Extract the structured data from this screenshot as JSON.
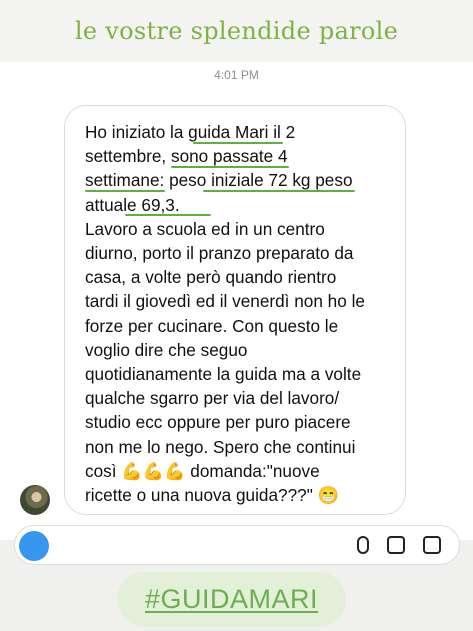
{
  "banner": {
    "title": "le vostre splendide parole"
  },
  "chat": {
    "timestamp": "4:01 PM",
    "message": "Ho iniziato la guida Mari il 2\nsettembre, sono passate 4\nsettimane: peso iniziale 72 kg peso\nattuale 69,3.\nLavoro a scuola ed in un centro\ndiurno, porto il pranzo preparato da\ncasa, a volte però quando rientro\ntardi il giovedì ed il venerdì non ho le\nforze per cucinare. Con questo le\nvoglio dire che seguo\nquotidianamente la guida ma a volte\nqualche sgarro per via del lavoro/\nstudio ecc oppure per puro piacere\nnon me lo nego. Spero che continui\ncosì 💪💪💪 domanda:\"nuove\nricette o una nuova guida???\" 😁",
    "highlight_color": "#5cb044"
  },
  "footer": {
    "hashtag": "#GUIDAMARI"
  },
  "colors": {
    "accent_green": "#7cb342",
    "bubble_border": "#dcdcdc",
    "camera_blue": "#3797f0"
  }
}
